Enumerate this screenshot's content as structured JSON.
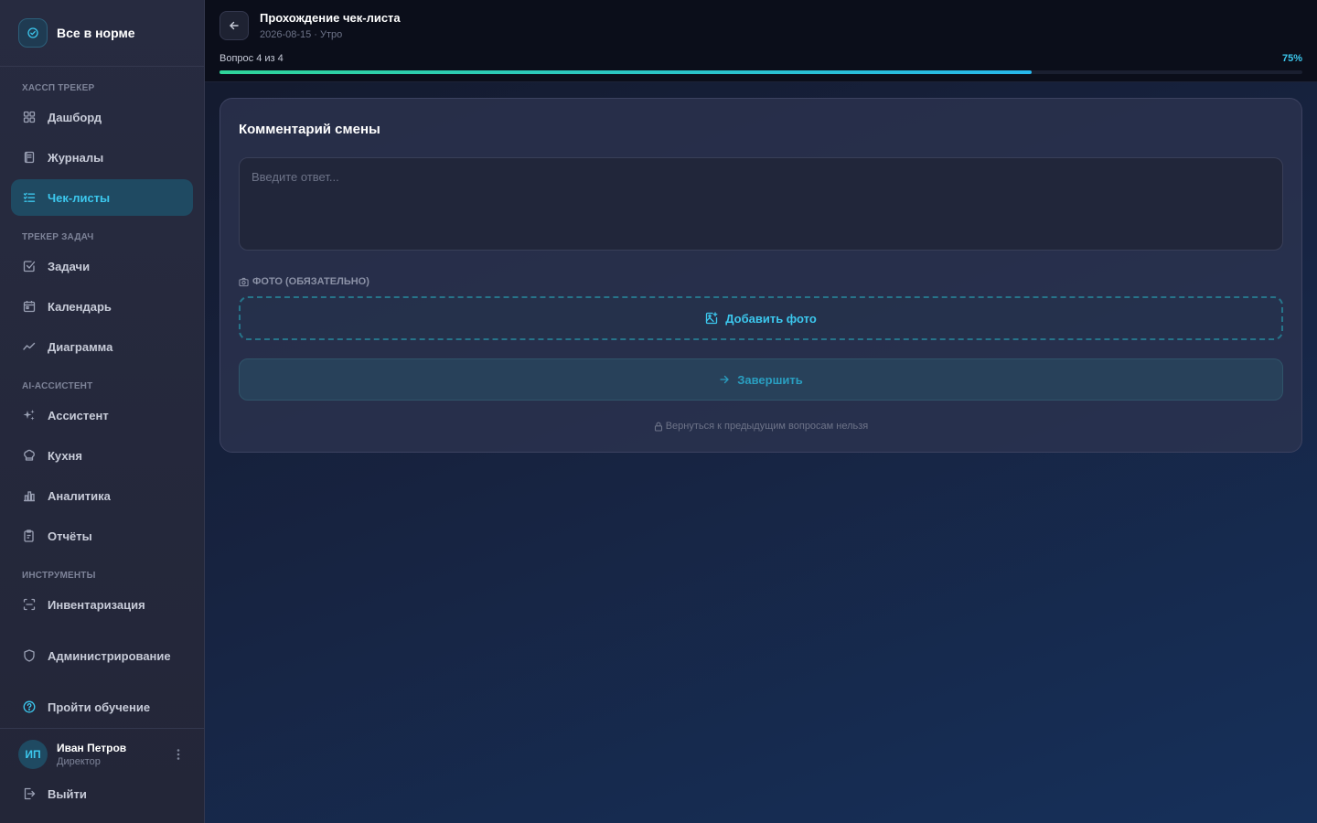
{
  "brand": {
    "title": "Все в норме",
    "icon": "status-ok-icon"
  },
  "sidebar": {
    "sections": [
      {
        "label": "ХАССП ТРЕКЕР"
      },
      {
        "label": "ТРЕКЕР ЗАДАЧ"
      },
      {
        "label": "AI-АССИСТЕНТ"
      },
      {
        "label": "ИНСТРУМЕНТЫ"
      }
    ],
    "items": [
      {
        "label": "Дашборд",
        "icon": "dashboard-icon"
      },
      {
        "label": "Журналы",
        "icon": "journal-icon"
      },
      {
        "label": "Чек-листы",
        "icon": "checklist-icon",
        "active": true
      },
      {
        "label": "Задачи",
        "icon": "task-icon"
      },
      {
        "label": "Календарь",
        "icon": "calendar-icon"
      },
      {
        "label": "Диаграмма",
        "icon": "chart-line-icon"
      },
      {
        "label": "Ассистент",
        "icon": "sparkles-icon"
      },
      {
        "label": "Кухня",
        "icon": "chef-hat-icon"
      },
      {
        "label": "Аналитика",
        "icon": "bar-chart-icon"
      },
      {
        "label": "Отчёты",
        "icon": "report-icon"
      },
      {
        "label": "Инвентаризация",
        "icon": "scan-icon"
      },
      {
        "label": "Администрирование",
        "icon": "shield-icon"
      },
      {
        "label": "Пройти обучение",
        "icon": "help-circle-icon"
      }
    ]
  },
  "user": {
    "initials": "ИП",
    "name": "Иван Петров",
    "role": "Директор",
    "logout_label": "Выйти"
  },
  "header": {
    "title": "Прохождение чек-листа",
    "date": "2026-08-15",
    "separator": "·",
    "shift": "Утро",
    "progress_label": "Вопрос 4 из 4",
    "progress_percent_label": "75%",
    "progress_fraction": 0.75
  },
  "question": {
    "title": "Комментарий смены",
    "answer_value": "",
    "answer_placeholder": "Введите ответ...",
    "photo_label": "ФОТО (ОБЯЗАТЕЛЬНО)",
    "add_photo_label": "Добавить фото",
    "finish_label": "Завершить",
    "note": "Вернуться к предыдущим вопросам нельзя"
  },
  "colors": {
    "accent": "#3cc8ee",
    "progress_start": "#2fd59a",
    "progress_end": "#27b8ec",
    "active_nav_bg": "#1f4a62"
  }
}
